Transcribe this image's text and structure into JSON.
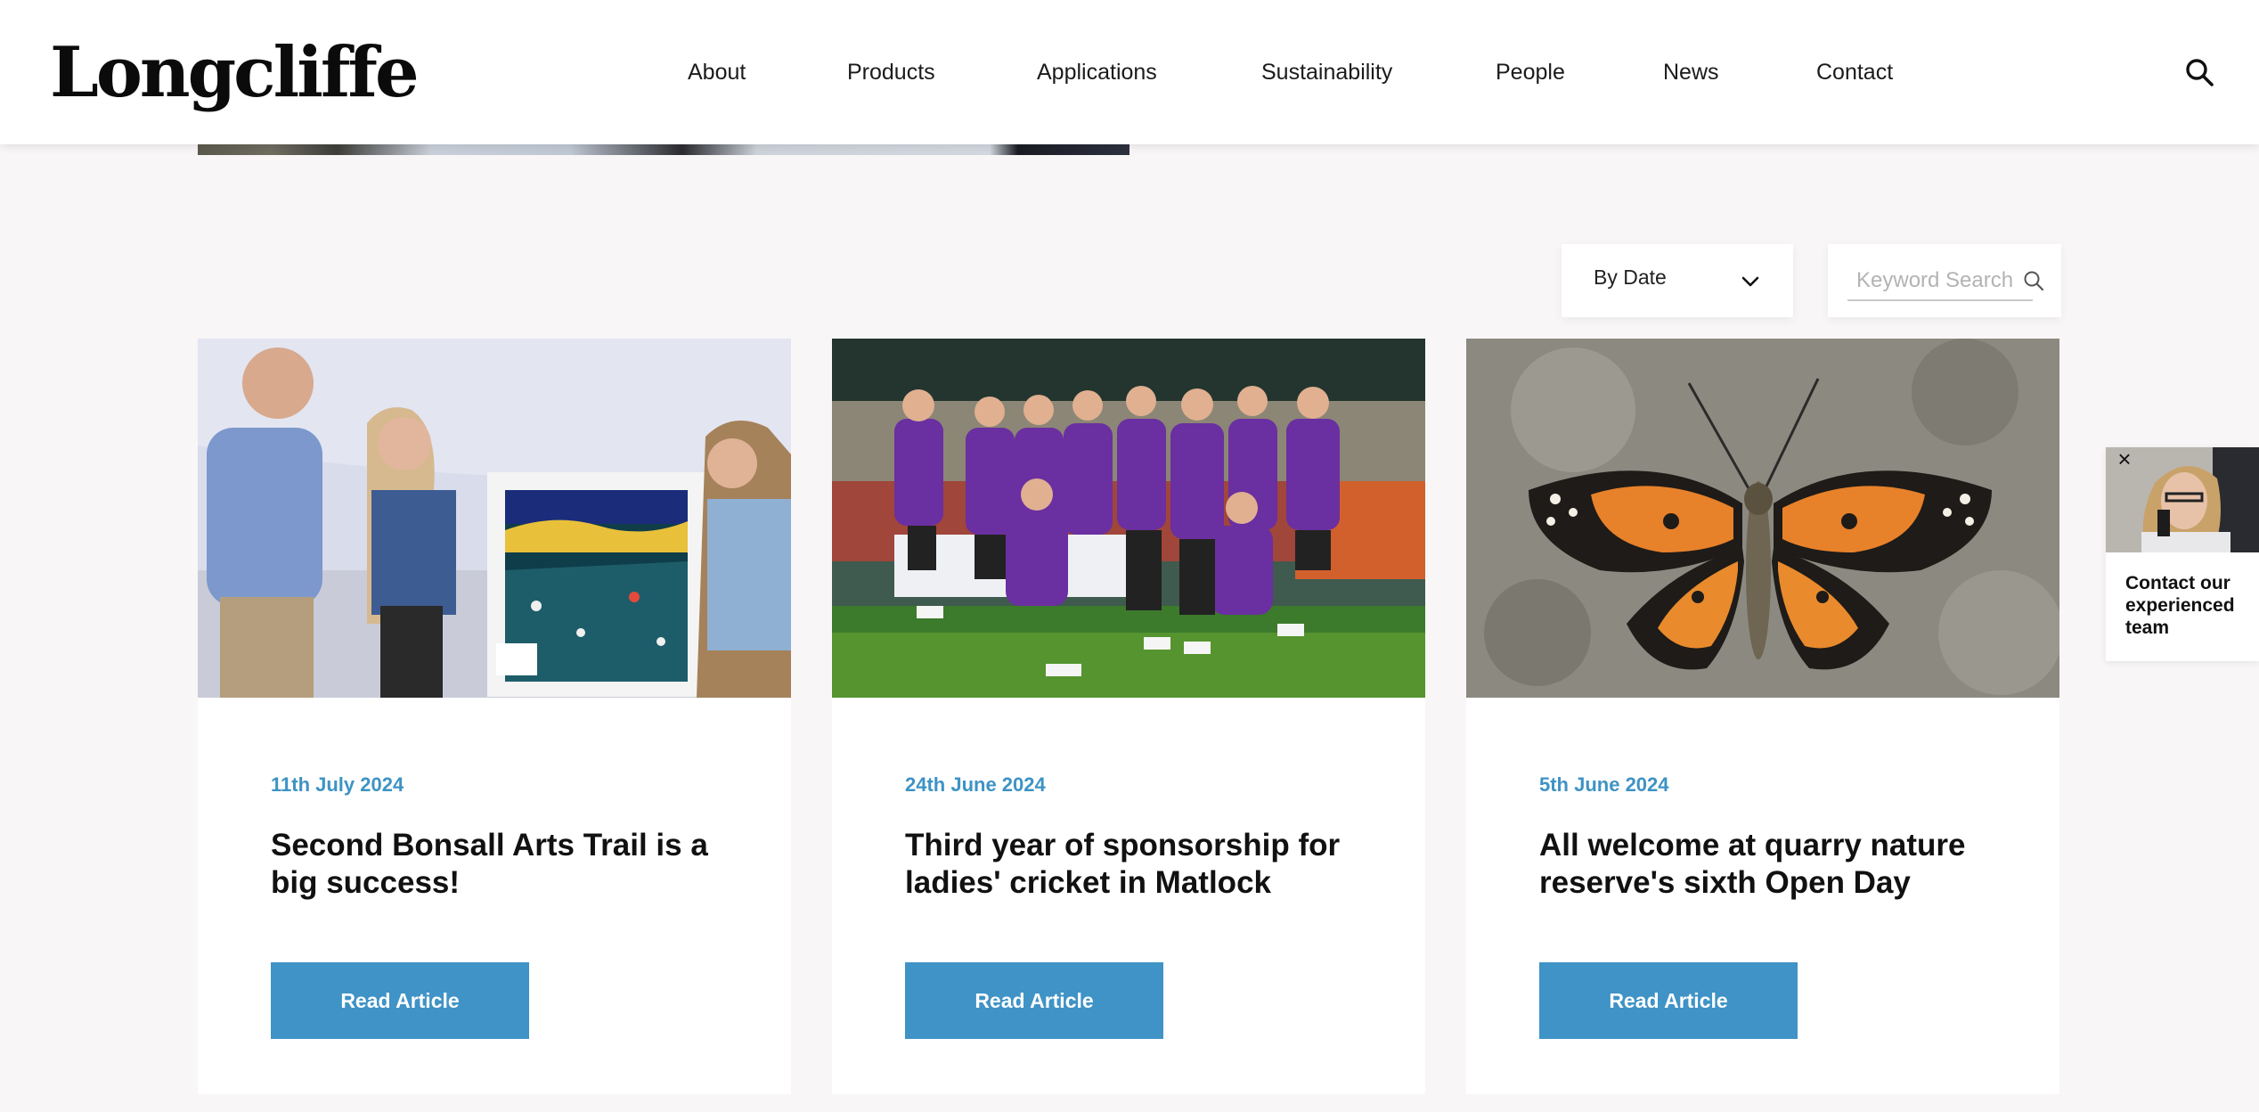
{
  "header": {
    "logo": "Longcliffe",
    "nav": [
      "About",
      "Products",
      "Applications",
      "Sustainability",
      "People",
      "News",
      "Contact"
    ]
  },
  "filters": {
    "sort_label": "By Date",
    "search_placeholder": "Keyword Search"
  },
  "articles": [
    {
      "date": "11th July 2024",
      "title": "Second Bonsall Arts Trail is a big success!",
      "button": "Read Article"
    },
    {
      "date": "24th June 2024",
      "title": "Third year of sponsorship for ladies' cricket in Matlock",
      "button": "Read Article"
    },
    {
      "date": "5th June 2024",
      "title": "All welcome at quarry nature reserve's sixth Open Day",
      "button": "Read Article"
    }
  ],
  "contact_widget": {
    "text": "Contact our experienced team"
  },
  "colors": {
    "accent": "#3f93c6",
    "date": "#3e93c4",
    "background": "#f8f6f6"
  }
}
